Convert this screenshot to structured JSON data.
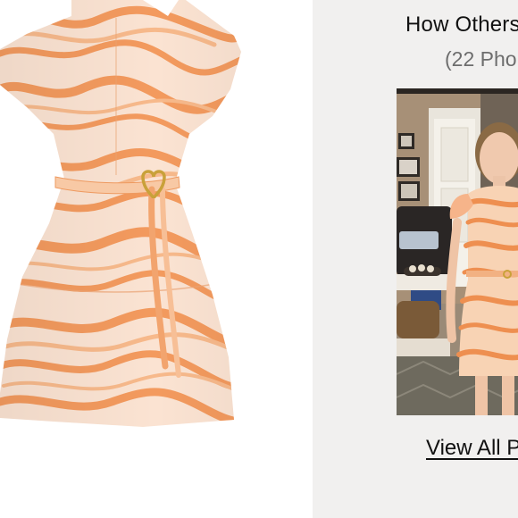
{
  "product": {
    "image_alt": "Orange and white zebra print belted mini dress with flutter sleeves and mock neck",
    "colors": {
      "base": "#fbe3d2",
      "stripe_dark": "#f39a5e",
      "stripe_light": "#f7b98b",
      "belt_buckle": "#c9a13a"
    }
  },
  "ugc": {
    "title": "How Others",
    "photo_count": "(22 Pho",
    "link": "View All P",
    "photo_alt": "Customer wearing the orange zebra print dress indoors"
  }
}
